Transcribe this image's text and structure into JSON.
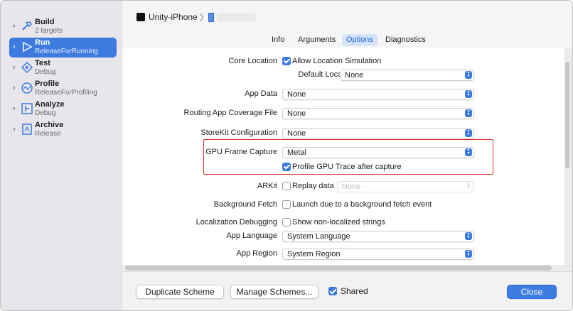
{
  "sidebar": {
    "items": [
      {
        "title": "Build",
        "subtitle": "2 targets",
        "icon": "hammer-icon"
      },
      {
        "title": "Run",
        "subtitle": "ReleaseForRunning",
        "icon": "play-icon",
        "selected": true
      },
      {
        "title": "Test",
        "subtitle": "Debug",
        "icon": "diamond-icon"
      },
      {
        "title": "Profile",
        "subtitle": "ReleaseForProfiling",
        "icon": "gauge-icon"
      },
      {
        "title": "Analyze",
        "subtitle": "Debug",
        "icon": "analyze-icon"
      },
      {
        "title": "Archive",
        "subtitle": "Release",
        "icon": "archive-icon"
      }
    ]
  },
  "header": {
    "target": "Unity-iPhone",
    "separator": "〉"
  },
  "tabs": [
    {
      "label": "Info"
    },
    {
      "label": "Arguments"
    },
    {
      "label": "Options",
      "active": true
    },
    {
      "label": "Diagnostics"
    }
  ],
  "options": {
    "core_location": {
      "label": "Core Location",
      "checkbox_label": "Allow Location Simulation",
      "checked": true
    },
    "default_location": {
      "label": "Default Location",
      "value": "None"
    },
    "app_data": {
      "label": "App Data",
      "value": "None"
    },
    "routing": {
      "label": "Routing App Coverage File",
      "value": "None"
    },
    "storekit": {
      "label": "StoreKit Configuration",
      "value": "None"
    },
    "gpu_frame_capture": {
      "label": "GPU Frame Capture",
      "value": "Metal"
    },
    "profile_gpu_trace": {
      "checkbox_label": "Profile GPU Trace after capture",
      "checked": true
    },
    "arkit": {
      "label": "ARKit",
      "checkbox_label": "Replay data",
      "checked": false,
      "value": "None"
    },
    "background_fetch": {
      "label": "Background Fetch",
      "checkbox_label": "Launch due to a background fetch event",
      "checked": false
    },
    "localization_debugging": {
      "label": "Localization Debugging",
      "checkbox_label": "Show non-localized strings",
      "checked": false
    },
    "app_language": {
      "label": "App Language",
      "value": "System Language"
    },
    "app_region": {
      "label": "App Region",
      "value": "System Region"
    }
  },
  "footer": {
    "duplicate": "Duplicate Scheme",
    "manage": "Manage Schemes...",
    "shared_label": "Shared",
    "shared_checked": true,
    "close": "Close"
  },
  "colors": {
    "accent": "#3d7be0",
    "highlight_box": "#d93025"
  }
}
